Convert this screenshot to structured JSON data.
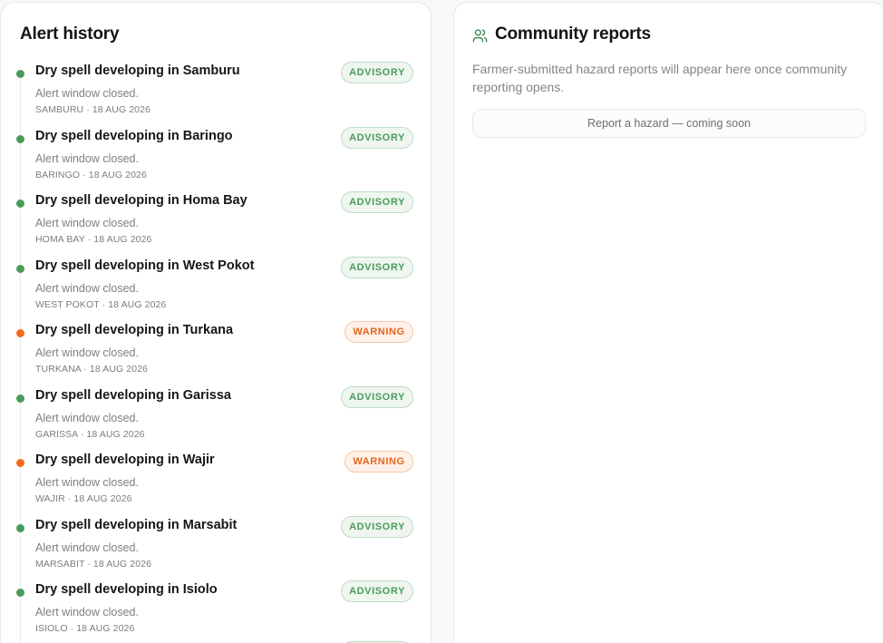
{
  "alert_history": {
    "title": "Alert history",
    "items": [
      {
        "title": "Dry spell developing in Samburu",
        "description": "Alert window closed.",
        "meta": "SAMBURU · 18 AUG 2026",
        "level": "advisory",
        "badge": "ADVISORY"
      },
      {
        "title": "Dry spell developing in Baringo",
        "description": "Alert window closed.",
        "meta": "BARINGO · 18 AUG 2026",
        "level": "advisory",
        "badge": "ADVISORY"
      },
      {
        "title": "Dry spell developing in Homa Bay",
        "description": "Alert window closed.",
        "meta": "HOMA BAY · 18 AUG 2026",
        "level": "advisory",
        "badge": "ADVISORY"
      },
      {
        "title": "Dry spell developing in West Pokot",
        "description": "Alert window closed.",
        "meta": "WEST POKOT · 18 AUG 2026",
        "level": "advisory",
        "badge": "ADVISORY"
      },
      {
        "title": "Dry spell developing in Turkana",
        "description": "Alert window closed.",
        "meta": "TURKANA · 18 AUG 2026",
        "level": "warning",
        "badge": "WARNING"
      },
      {
        "title": "Dry spell developing in Garissa",
        "description": "Alert window closed.",
        "meta": "GARISSA · 18 AUG 2026",
        "level": "advisory",
        "badge": "ADVISORY"
      },
      {
        "title": "Dry spell developing in Wajir",
        "description": "Alert window closed.",
        "meta": "WAJIR · 18 AUG 2026",
        "level": "warning",
        "badge": "WARNING"
      },
      {
        "title": "Dry spell developing in Marsabit",
        "description": "Alert window closed.",
        "meta": "MARSABIT · 18 AUG 2026",
        "level": "advisory",
        "badge": "ADVISORY"
      },
      {
        "title": "Dry spell developing in Isiolo",
        "description": "Alert window closed.",
        "meta": "ISIOLO · 18 AUG 2026",
        "level": "advisory",
        "badge": "ADVISORY"
      }
    ]
  },
  "community_reports": {
    "title": "Community reports",
    "icon": "users-icon",
    "description": "Farmer-submitted hazard reports will appear here once community reporting opens.",
    "report_button_label": "Report a hazard — coming soon"
  },
  "colors": {
    "advisory": "#4a9b5a",
    "warning": "#f26b1d"
  }
}
